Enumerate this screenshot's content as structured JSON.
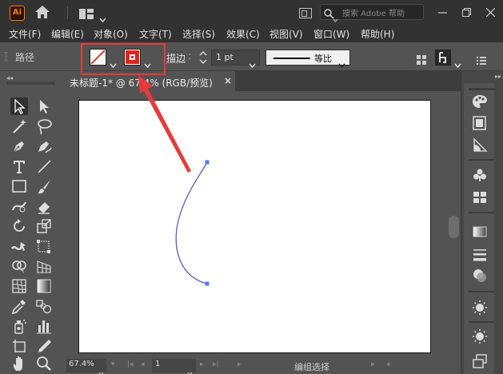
{
  "app": {
    "logo_text": "Ai",
    "accent_color": "#ff7c00"
  },
  "titlebar": {
    "search_placeholder": "搜索 Adobe 帮助"
  },
  "menu": [
    {
      "label": "文件(F)"
    },
    {
      "label": "编辑(E)"
    },
    {
      "label": "对象(O)"
    },
    {
      "label": "文字(T)"
    },
    {
      "label": "选择(S)"
    },
    {
      "label": "效果(C)"
    },
    {
      "label": "视图(V)"
    },
    {
      "label": "窗口(W)"
    },
    {
      "label": "帮助(H)"
    }
  ],
  "control": {
    "selection_label": "路径",
    "fill_icon": "none-swatch-icon",
    "stroke_color": "#e0241b",
    "stroke_label": "描边",
    "stroke_weight": "1 pt",
    "profile_label": "等比"
  },
  "callout": {
    "color": "#e83a3a"
  },
  "document": {
    "tab_title": "未标题-1* @ 67.4% (RGB/预览)",
    "close_glyph": "×"
  },
  "path": {
    "stroke_color": "#6a56b8",
    "anchor_color": "#4e7bff"
  },
  "status": {
    "zoom": "67.4%",
    "artboard": "1",
    "mode_text": "编组选择"
  },
  "tools": [
    "selection-tool",
    "direct-selection-tool",
    "magic-wand-tool",
    "lasso-tool",
    "pen-tool",
    "curvature-tool",
    "type-tool",
    "line-segment-tool",
    "rectangle-tool",
    "paintbrush-tool",
    "shaper-tool",
    "eraser-tool",
    "rotate-tool",
    "scale-tool",
    "width-tool",
    "free-transform-tool",
    "shape-builder-tool",
    "perspective-grid-tool",
    "mesh-tool",
    "gradient-tool",
    "eyedropper-tool",
    "blend-tool",
    "symbol-sprayer-tool",
    "column-graph-tool",
    "artboard-tool",
    "slice-tool",
    "hand-tool",
    "zoom-tool"
  ],
  "dock": [
    "color-palette-icon",
    "swatches-icon",
    "color-guide-icon",
    "symbols-icon",
    "brushes-icon",
    "gradient-icon",
    "stroke-icon",
    "transparency-icon",
    "appearance-icon",
    "graphic-styles-icon",
    "layers-icon"
  ]
}
